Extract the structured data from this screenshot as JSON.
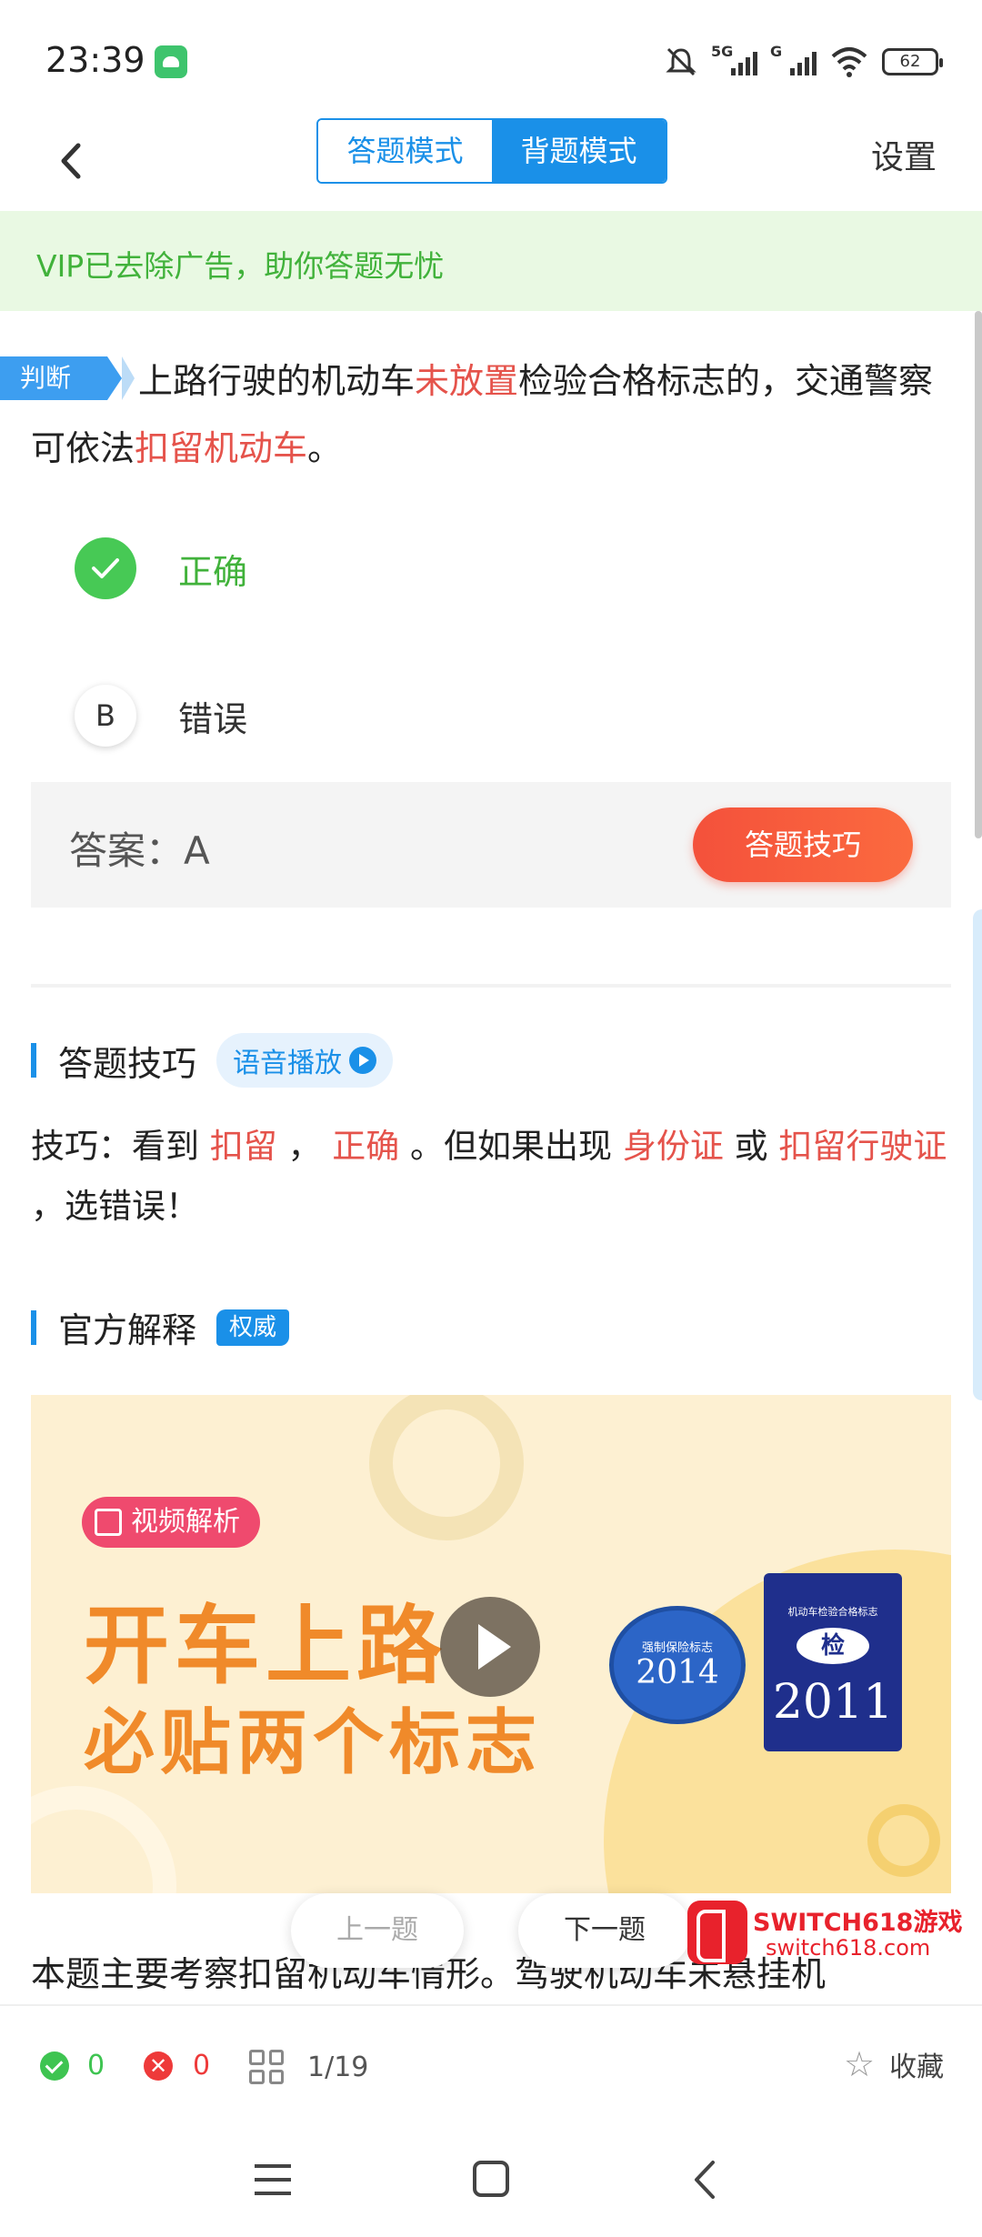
{
  "status_bar": {
    "time": "23:39",
    "network_1": "5G",
    "network_2": "G",
    "battery": "62",
    "icons": [
      "android-app-icon",
      "mute-icon",
      "signal-icon",
      "wifi-icon",
      "battery-icon"
    ]
  },
  "header": {
    "mode_answer": "答题模式",
    "mode_review": "背题模式",
    "active_mode": "背题模式",
    "settings": "设置"
  },
  "vip_banner": "VIP已去除广告，助你答题无忧",
  "question": {
    "type_tag": "判断",
    "parts": [
      {
        "text": "上路行驶的机动车",
        "highlight": false
      },
      {
        "text": "未放置",
        "highlight": true
      },
      {
        "text": "检验合格标志的，交通警察可依法",
        "highlight": false
      },
      {
        "text": "扣留机动车",
        "highlight": true
      },
      {
        "text": "。",
        "highlight": false
      }
    ]
  },
  "options": [
    {
      "letter": "A",
      "text": "正确",
      "state": "correct"
    },
    {
      "letter": "B",
      "text": "错误",
      "state": "normal"
    }
  ],
  "answer": {
    "text": "答案：A",
    "tips_button": "答题技巧"
  },
  "tips_section": {
    "title": "答题技巧",
    "voice_button": "语音播放",
    "parts": [
      {
        "text": "技巧：看到 ",
        "highlight": false
      },
      {
        "text": "扣留",
        "highlight": true
      },
      {
        "text": " ， ",
        "highlight": false
      },
      {
        "text": "正确",
        "highlight": true
      },
      {
        "text": " 。但如果出现 ",
        "highlight": false
      },
      {
        "text": "身份证",
        "highlight": true
      },
      {
        "text": " 或 ",
        "highlight": false
      },
      {
        "text": "扣留行驶证",
        "highlight": true
      },
      {
        "text": " ，选错误！",
        "highlight": false
      }
    ]
  },
  "official_section": {
    "title": "官方解释",
    "badge": "权威"
  },
  "video": {
    "label": "视频解析",
    "line1": "开车上路",
    "line2": "必贴两个标志",
    "insurance_year": "2014",
    "insurance_label": "强制保险标志",
    "inspection_label": "机动车检验合格标志",
    "inspection_mark": "检",
    "inspection_year": "2011"
  },
  "nav": {
    "prev": "上一题",
    "next": "下一题"
  },
  "watermark": {
    "line1": "SWITCH618游戏",
    "line2": "switch618.com"
  },
  "explanation_text": "本题主要考察扣留机动车情形。驾驶机动车未悬挂机",
  "bottom_bar": {
    "correct_count": "0",
    "wrong_count": "0",
    "progress": "1/19",
    "favorite": "收藏"
  },
  "colors": {
    "primary": "#1a90e8",
    "highlight_red": "#e5534b",
    "correct_green": "#47c955",
    "vip_bg": "#e9f9e3"
  }
}
